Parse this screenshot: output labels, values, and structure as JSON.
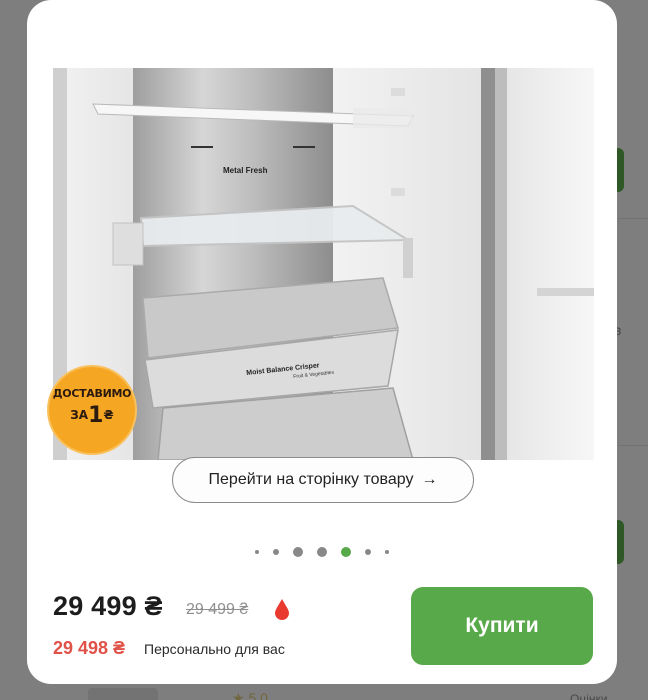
{
  "background": {
    "side_text": "в",
    "rating_text": "★ 5.0",
    "right_bottom_text": "Оцінки"
  },
  "modal": {
    "image_alt": "Холодильник LG, вигляд з відчиненими дверима",
    "photo_texts": {
      "panel_label": "Metal Fresh",
      "crisper_label": "Moist Balance Crisper",
      "crisper_sub": "Fruit & Vegetables"
    },
    "delivery_badge": {
      "line1": "ДОСТАВИМО",
      "line2_prefix": "ЗА",
      "line2_big": "1",
      "line2_currency": "₴"
    },
    "goto_button": {
      "label": "Перейти на сторінку товару",
      "arrow": "→"
    },
    "carousel": {
      "active_index": 4,
      "count": 7
    },
    "price": {
      "current": "29 499 ₴",
      "old": "29 499 ₴",
      "personal": "29 498 ₴",
      "personal_label": "Персонально для вас"
    },
    "buy_button": {
      "label": "Купити"
    },
    "colors": {
      "accent_green": "#58a94a",
      "personal_red": "#e05148",
      "badge_orange": "#f5a623"
    },
    "icons": {
      "promo": "red-drop-icon",
      "goto": "arrow-right-icon"
    }
  }
}
